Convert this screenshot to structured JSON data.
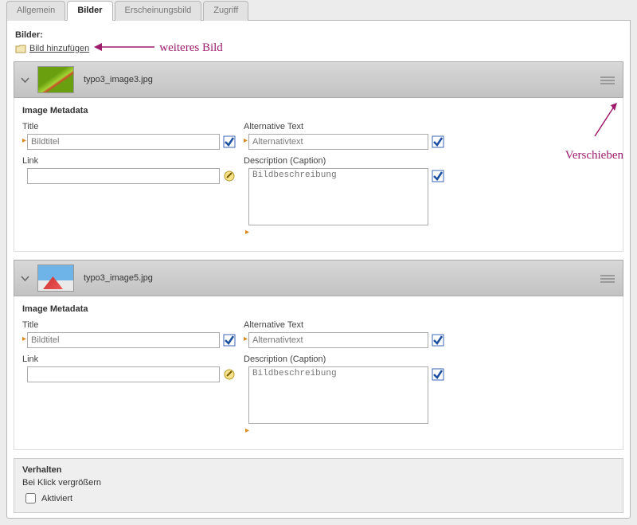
{
  "tabs": {
    "general": "Allgemein",
    "images": "Bilder",
    "appearance": "Erscheinungsbild",
    "access": "Zugriff"
  },
  "section_label": "Bilder:",
  "add_image_label": "Bild hinzufügen",
  "annot_add": "weiteres Bild",
  "annot_move": "Verschieben",
  "metadata_heading": "Image Metadata",
  "labels": {
    "title": "Title",
    "link": "Link",
    "alt": "Alternative Text",
    "desc": "Description (Caption)"
  },
  "items": [
    {
      "filename": "typo3_image3.jpg",
      "title_value": "Bildtitel",
      "alt_value": "Alternativtext",
      "desc_value": "Bildbeschreibung",
      "link_value": ""
    },
    {
      "filename": "typo3_image5.jpg",
      "title_value": "Bildtitel",
      "alt_value": "Alternativtext",
      "desc_value": "Bildbeschreibung",
      "link_value": ""
    }
  ],
  "behaviour": {
    "heading": "Verhalten",
    "enlarge": "Bei Klick vergrößern",
    "activated": "Aktiviert"
  }
}
